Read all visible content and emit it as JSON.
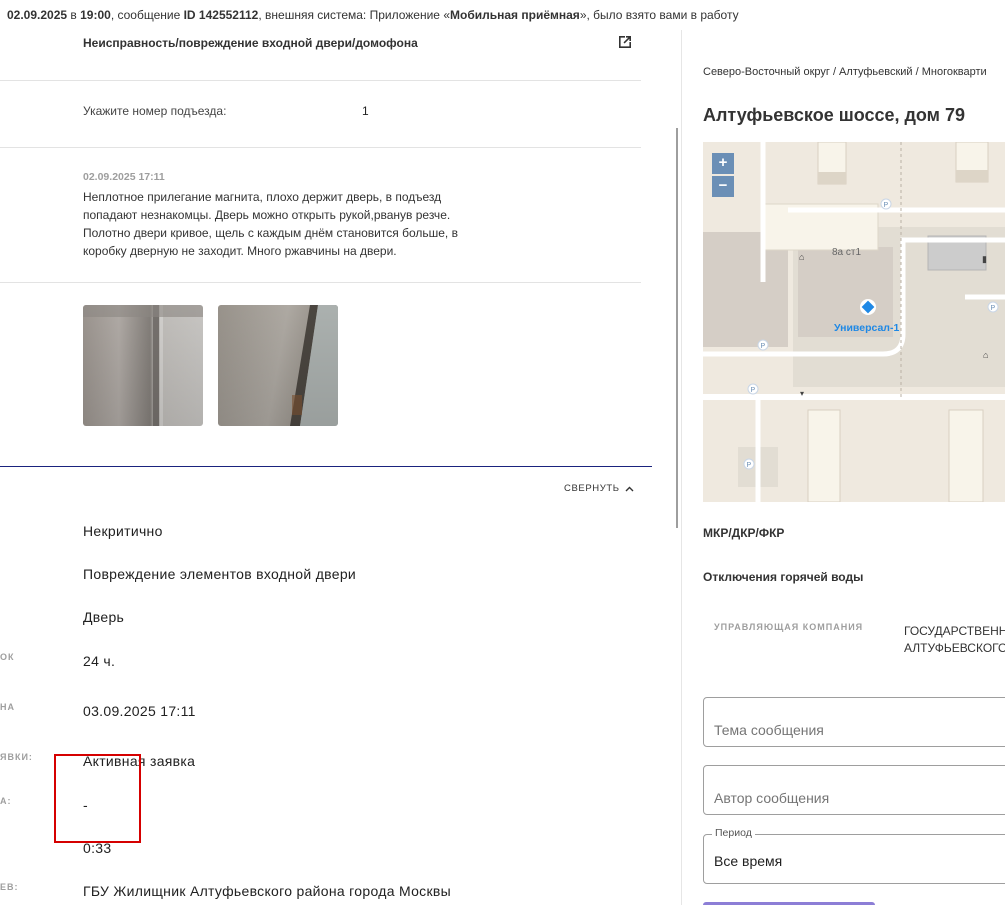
{
  "topbar": {
    "date": "02.09.2025",
    "in": " в ",
    "time": "19:00",
    "msg_prefix": ", сообщение ",
    "msg_id": "ID 142552112",
    "ext_prefix": ", внешняя система: Приложение «",
    "ext_name": "Мобильная приёмная",
    "ext_suffix": "», было взято вами в работу"
  },
  "request": {
    "topic": "Неисправность/повреждение входной двери/домофона",
    "entrance_label": "Укажите номер подъезда:",
    "entrance_value": "1",
    "comment_date": "02.09.2025 17:11",
    "comment_text": "Неплотное прилегание магнита, плохо держит дверь, в подъезд попадают незнакомцы. Дверь можно открыть рукой,рванув резче. Полотно двери кривое, щель с каждым днём становится больше, в коробку дверную не заходит. Много ржавчины на двери.",
    "collapse_label": "СВЕРНУТЬ"
  },
  "fields": [
    {
      "label": "",
      "value": "Некритично"
    },
    {
      "label": "",
      "value": "Повреждение элементов входной двери"
    },
    {
      "label": "",
      "value": "Дверь"
    },
    {
      "label": "ОК",
      "value": "24 ч."
    },
    {
      "label": "НА",
      "value": "03.09.2025 17:11"
    },
    {
      "label": "ЯВКИ:",
      "value": "Активная заявка"
    },
    {
      "label": "А:",
      "value": "-"
    },
    {
      "label": "",
      "value": "0:33"
    },
    {
      "label": "ЕВ:",
      "value": "ГБУ Жилищник Алтуфьевского района города Москвы"
    }
  ],
  "right": {
    "breadcrumb": "Северо-Восточный округ / Алтуфьевский / Многокварти",
    "address": "Алтуфьевское шоссе, дом 79",
    "map": {
      "zoom_in": "+",
      "zoom_out": "−",
      "poi_label": "Универсал-1",
      "building_label": "8а ст1",
      "parking": "P"
    },
    "mkr": "МКР/ДКР/ФКР",
    "hot_water": "Отключения горячей воды",
    "uk_label": "УПРАВЛЯЮЩАЯ КОМПАНИЯ",
    "uk_value_line1": "ГОСУДАРСТВЕНН",
    "uk_value_line2": "АЛТУФЬЕВСКОГО",
    "subject_placeholder": "Тема сообщения",
    "author_placeholder": "Автор сообщения",
    "period_label": "Период",
    "period_value": "Все время"
  },
  "colors": {
    "accent_line": "#1a237e",
    "highlight_box": "#d50000",
    "zoom_buttons": "#6b8fb6",
    "poi_blue": "#1e88e5",
    "button_purple": "#8c7ed6"
  }
}
